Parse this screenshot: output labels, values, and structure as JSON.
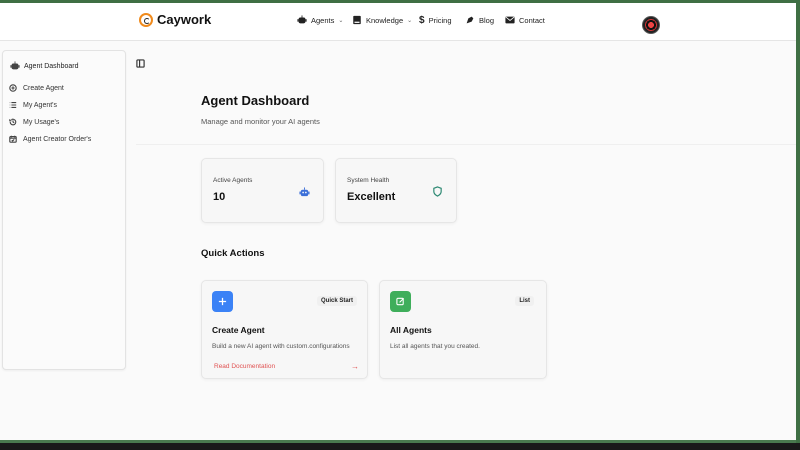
{
  "header": {
    "brand": "Caywork",
    "nav": {
      "agents": "Agents",
      "knowledge": "Knowledge",
      "pricing": "Pricing",
      "blog": "Blog",
      "contact": "Contact"
    }
  },
  "sidebar": {
    "title": "Agent Dashboard",
    "items": [
      {
        "label": "Create Agent",
        "icon": "plus-circle-icon"
      },
      {
        "label": "My Agent's",
        "icon": "list-icon"
      },
      {
        "label": "My Usage's",
        "icon": "history-icon"
      },
      {
        "label": "Agent Creator Order's",
        "icon": "calendar-check-icon"
      }
    ]
  },
  "main": {
    "title": "Agent Dashboard",
    "subtitle": "Manage and monitor your AI agents",
    "stats": [
      {
        "label": "Active Agents",
        "value": "10",
        "icon": "robot-icon",
        "color": "#3b6fd8"
      },
      {
        "label": "System Health",
        "value": "Excellent",
        "icon": "shield-icon",
        "color": "#2f8a74"
      }
    ],
    "quick_actions_title": "Quick Actions",
    "quick_actions": [
      {
        "badge": "Quick Start",
        "title": "Create Agent",
        "description": "Build a new AI agent with custom.configurations",
        "link": "Read Documentation",
        "icon": "plus-icon",
        "color": "#3b82f6"
      },
      {
        "badge": "List",
        "title": "All Agents",
        "description": "List all agents that you created.",
        "icon": "edit-icon",
        "color": "#3fae5b"
      }
    ]
  },
  "colors": {
    "link": "#e05252",
    "accent_orange": "#f08a1c"
  }
}
